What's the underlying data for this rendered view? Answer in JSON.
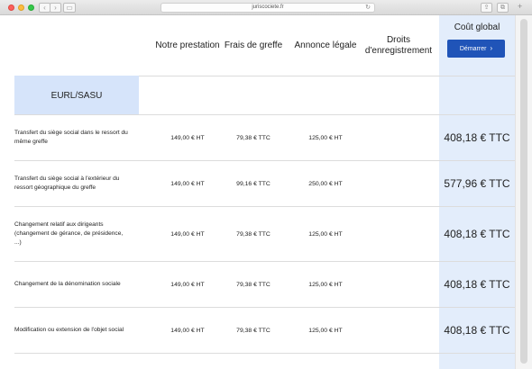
{
  "browser": {
    "url": "juriscociete.fr",
    "back_icon": "chevron-left-icon",
    "forward_icon": "chevron-right-icon"
  },
  "table": {
    "headers": {
      "prestation": "Notre prestation",
      "greffe": "Frais de greffe",
      "annonce": "Annonce légale",
      "droits": "Droits d'enregistrement",
      "global": "Coût global"
    },
    "start_button": "Démarrer",
    "category": "EURL/SASU",
    "rows": [
      {
        "label": "Transfert du siège social dans le ressort du même greffe",
        "prestation": "149,00 € HT",
        "greffe": "79,38 € TTC",
        "annonce": "125,00 € HT",
        "droits": "",
        "global": "408,18 € TTC"
      },
      {
        "label": "Transfert du siège social à l'extérieur du ressort géographique du greffe",
        "prestation": "149,00 € HT",
        "greffe": "99,16 € TTC",
        "annonce": "250,00 € HT",
        "droits": "",
        "global": "577,96 € TTC"
      },
      {
        "label": "Changement relatif aux dirigeants (changement de gérance, de présidence, ...)",
        "prestation": "149,00 € HT",
        "greffe": "79,38 € TTC",
        "annonce": "125,00 € HT",
        "droits": "",
        "global": "408,18 € TTC"
      },
      {
        "label": "Changement de la dénomination sociale",
        "prestation": "149,00 € HT",
        "greffe": "79,38 € TTC",
        "annonce": "125,00 € HT",
        "droits": "",
        "global": "408,18 € TTC"
      },
      {
        "label": "Modification ou extension de l'objet social",
        "prestation": "149,00 € HT",
        "greffe": "79,38 € TTC",
        "annonce": "125,00 € HT",
        "droits": "",
        "global": "408,18 € TTC"
      }
    ]
  },
  "colors": {
    "accent": "#2054b8",
    "global_column": "#e3edfb",
    "category_band": "#d6e4fa"
  }
}
